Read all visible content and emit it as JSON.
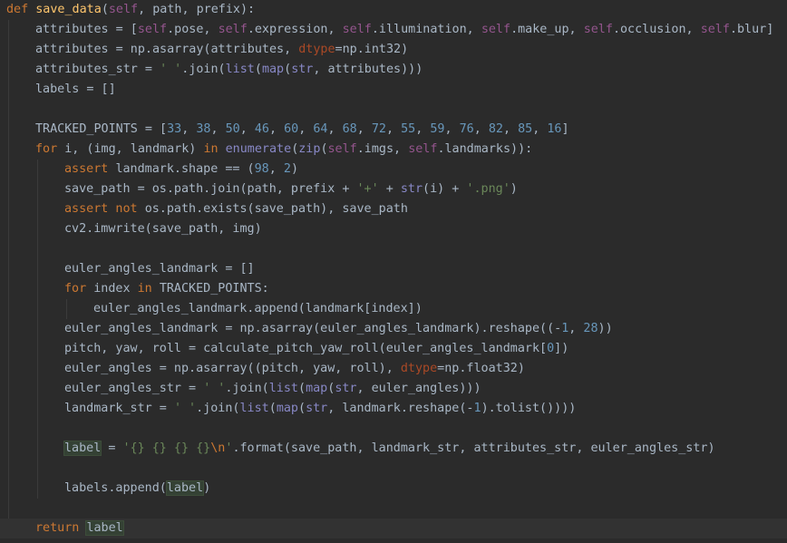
{
  "editor": {
    "language": "python",
    "colors": {
      "background": "#2b2b2b",
      "current_line": "#323232",
      "text": "#a9b7c6",
      "keyword": "#cc7832",
      "self": "#94558d",
      "function": "#ffc66d",
      "number": "#6897bb",
      "string": "#6a8759",
      "builtin": "#8888c6",
      "keyword_arg": "#aa4926"
    },
    "current_line_index": 26,
    "lines": [
      {
        "indent": 0,
        "tokens": [
          [
            "kw",
            "def "
          ],
          [
            "fn",
            "save_data"
          ],
          [
            "text",
            "("
          ],
          [
            "self",
            "self"
          ],
          [
            "text",
            ", path, prefix):"
          ]
        ]
      },
      {
        "indent": 1,
        "tokens": [
          [
            "text",
            "attributes = ["
          ],
          [
            "self",
            "self"
          ],
          [
            "text",
            ".pose, "
          ],
          [
            "self",
            "self"
          ],
          [
            "text",
            ".expression, "
          ],
          [
            "self",
            "self"
          ],
          [
            "text",
            ".illumination, "
          ],
          [
            "self",
            "self"
          ],
          [
            "text",
            ".make_up, "
          ],
          [
            "self",
            "self"
          ],
          [
            "text",
            ".occlusion, "
          ],
          [
            "self",
            "self"
          ],
          [
            "text",
            ".blur]"
          ]
        ]
      },
      {
        "indent": 1,
        "tokens": [
          [
            "text",
            "attributes = np.asarray(attributes, "
          ],
          [
            "param",
            "dtype"
          ],
          [
            "text",
            "=np.int32)"
          ]
        ]
      },
      {
        "indent": 1,
        "tokens": [
          [
            "text",
            "attributes_str = "
          ],
          [
            "str",
            "' '"
          ],
          [
            "text",
            ".join("
          ],
          [
            "bi",
            "list"
          ],
          [
            "text",
            "("
          ],
          [
            "bi",
            "map"
          ],
          [
            "text",
            "("
          ],
          [
            "bi",
            "str"
          ],
          [
            "text",
            ", attributes)))"
          ]
        ]
      },
      {
        "indent": 1,
        "tokens": [
          [
            "text",
            "labels = []"
          ]
        ]
      },
      {
        "indent": 0,
        "tokens": []
      },
      {
        "indent": 1,
        "tokens": [
          [
            "text",
            "TRACKED_POINTS = ["
          ],
          [
            "num",
            "33"
          ],
          [
            "text",
            ", "
          ],
          [
            "num",
            "38"
          ],
          [
            "text",
            ", "
          ],
          [
            "num",
            "50"
          ],
          [
            "text",
            ", "
          ],
          [
            "num",
            "46"
          ],
          [
            "text",
            ", "
          ],
          [
            "num",
            "60"
          ],
          [
            "text",
            ", "
          ],
          [
            "num",
            "64"
          ],
          [
            "text",
            ", "
          ],
          [
            "num",
            "68"
          ],
          [
            "text",
            ", "
          ],
          [
            "num",
            "72"
          ],
          [
            "text",
            ", "
          ],
          [
            "num",
            "55"
          ],
          [
            "text",
            ", "
          ],
          [
            "num",
            "59"
          ],
          [
            "text",
            ", "
          ],
          [
            "num",
            "76"
          ],
          [
            "text",
            ", "
          ],
          [
            "num",
            "82"
          ],
          [
            "text",
            ", "
          ],
          [
            "num",
            "85"
          ],
          [
            "text",
            ", "
          ],
          [
            "num",
            "16"
          ],
          [
            "text",
            "]"
          ]
        ]
      },
      {
        "indent": 1,
        "tokens": [
          [
            "kw",
            "for "
          ],
          [
            "text",
            "i, (img, landmark) "
          ],
          [
            "kw",
            "in "
          ],
          [
            "bi",
            "enumerate"
          ],
          [
            "text",
            "("
          ],
          [
            "bi",
            "zip"
          ],
          [
            "text",
            "("
          ],
          [
            "self",
            "self"
          ],
          [
            "text",
            ".imgs, "
          ],
          [
            "self",
            "self"
          ],
          [
            "text",
            ".landmarks)):"
          ]
        ]
      },
      {
        "indent": 2,
        "tokens": [
          [
            "kw",
            "assert "
          ],
          [
            "text",
            "landmark.shape == ("
          ],
          [
            "num",
            "98"
          ],
          [
            "text",
            ", "
          ],
          [
            "num",
            "2"
          ],
          [
            "text",
            ")"
          ]
        ]
      },
      {
        "indent": 2,
        "tokens": [
          [
            "text",
            "save_path = os.path.join(path, prefix + "
          ],
          [
            "str",
            "'+'"
          ],
          [
            "text",
            " + "
          ],
          [
            "bi",
            "str"
          ],
          [
            "text",
            "(i) + "
          ],
          [
            "str",
            "'.png'"
          ],
          [
            "text",
            ")"
          ]
        ]
      },
      {
        "indent": 2,
        "tokens": [
          [
            "kw",
            "assert not "
          ],
          [
            "text",
            "os.path.exists(save_path), save_path"
          ]
        ]
      },
      {
        "indent": 2,
        "tokens": [
          [
            "text",
            "cv2.imwrite(save_path, img)"
          ]
        ]
      },
      {
        "indent": 0,
        "tokens": []
      },
      {
        "indent": 2,
        "tokens": [
          [
            "text",
            "euler_angles_landmark = []"
          ]
        ]
      },
      {
        "indent": 2,
        "tokens": [
          [
            "kw",
            "for "
          ],
          [
            "text",
            "index "
          ],
          [
            "kw",
            "in "
          ],
          [
            "text",
            "TRACKED_POINTS:"
          ]
        ]
      },
      {
        "indent": 3,
        "tokens": [
          [
            "text",
            "euler_angles_landmark.append(landmark[index])"
          ]
        ]
      },
      {
        "indent": 2,
        "tokens": [
          [
            "text",
            "euler_angles_landmark = np.asarray(euler_angles_landmark).reshape((-"
          ],
          [
            "num",
            "1"
          ],
          [
            "text",
            ", "
          ],
          [
            "num",
            "28"
          ],
          [
            "text",
            "))"
          ]
        ]
      },
      {
        "indent": 2,
        "tokens": [
          [
            "text",
            "pitch, yaw, roll = calculate_pitch_yaw_roll(euler_angles_landmark["
          ],
          [
            "num",
            "0"
          ],
          [
            "text",
            "])"
          ]
        ]
      },
      {
        "indent": 2,
        "tokens": [
          [
            "text",
            "euler_angles = np.asarray((pitch, yaw, roll), "
          ],
          [
            "param",
            "dtype"
          ],
          [
            "text",
            "=np.float32)"
          ]
        ]
      },
      {
        "indent": 2,
        "tokens": [
          [
            "text",
            "euler_angles_str = "
          ],
          [
            "str",
            "' '"
          ],
          [
            "text",
            ".join("
          ],
          [
            "bi",
            "list"
          ],
          [
            "text",
            "("
          ],
          [
            "bi",
            "map"
          ],
          [
            "text",
            "("
          ],
          [
            "bi",
            "str"
          ],
          [
            "text",
            ", euler_angles)))"
          ]
        ]
      },
      {
        "indent": 2,
        "tokens": [
          [
            "text",
            "landmark_str = "
          ],
          [
            "str",
            "' '"
          ],
          [
            "text",
            ".join("
          ],
          [
            "bi",
            "list"
          ],
          [
            "text",
            "("
          ],
          [
            "bi",
            "map"
          ],
          [
            "text",
            "("
          ],
          [
            "bi",
            "str"
          ],
          [
            "text",
            ", landmark.reshape(-"
          ],
          [
            "num",
            "1"
          ],
          [
            "text",
            ").tolist())))"
          ]
        ]
      },
      {
        "indent": 0,
        "tokens": []
      },
      {
        "indent": 2,
        "tokens": [
          [
            "hl",
            "label"
          ],
          [
            "text",
            " = "
          ],
          [
            "str",
            "'{} {} {} {}"
          ],
          [
            "esc",
            "\\n"
          ],
          [
            "str",
            "'"
          ],
          [
            "text",
            ".format(save_path, landmark_str, attributes_str, euler_angles_str)"
          ]
        ]
      },
      {
        "indent": 0,
        "tokens": []
      },
      {
        "indent": 2,
        "tokens": [
          [
            "text",
            "labels.append("
          ],
          [
            "hl",
            "label"
          ],
          [
            "text",
            ")"
          ]
        ]
      },
      {
        "indent": 0,
        "tokens": []
      },
      {
        "indent": 1,
        "tokens": [
          [
            "kw",
            "return "
          ],
          [
            "hl",
            "label"
          ]
        ]
      }
    ]
  }
}
